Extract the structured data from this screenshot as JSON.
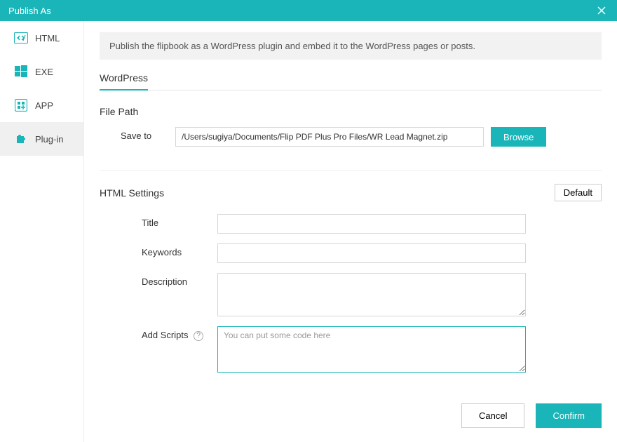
{
  "window": {
    "title": "Publish As"
  },
  "sidebar": {
    "items": [
      {
        "label": "HTML",
        "icon": "code-icon"
      },
      {
        "label": "EXE",
        "icon": "windows-icon"
      },
      {
        "label": "APP",
        "icon": "app-icon"
      },
      {
        "label": "Plug-in",
        "icon": "puzzle-icon"
      }
    ],
    "active_index": 3
  },
  "main": {
    "intro": "Publish the flipbook as a WordPress plugin and embed it to the WordPress pages or posts.",
    "section_title": "WordPress",
    "filepath": {
      "heading": "File Path",
      "label": "Save to",
      "value": "/Users/sugiya/Documents/Flip PDF Plus Pro Files/WR Lead Magnet.zip",
      "browse": "Browse"
    },
    "settings": {
      "heading": "HTML Settings",
      "default_btn": "Default",
      "title_label": "Title",
      "title_value": "",
      "keywords_label": "Keywords",
      "keywords_value": "",
      "description_label": "Description",
      "description_value": "",
      "scripts_label": "Add Scripts",
      "scripts_placeholder": "You can put some code here",
      "scripts_value": ""
    }
  },
  "footer": {
    "cancel": "Cancel",
    "confirm": "Confirm"
  }
}
